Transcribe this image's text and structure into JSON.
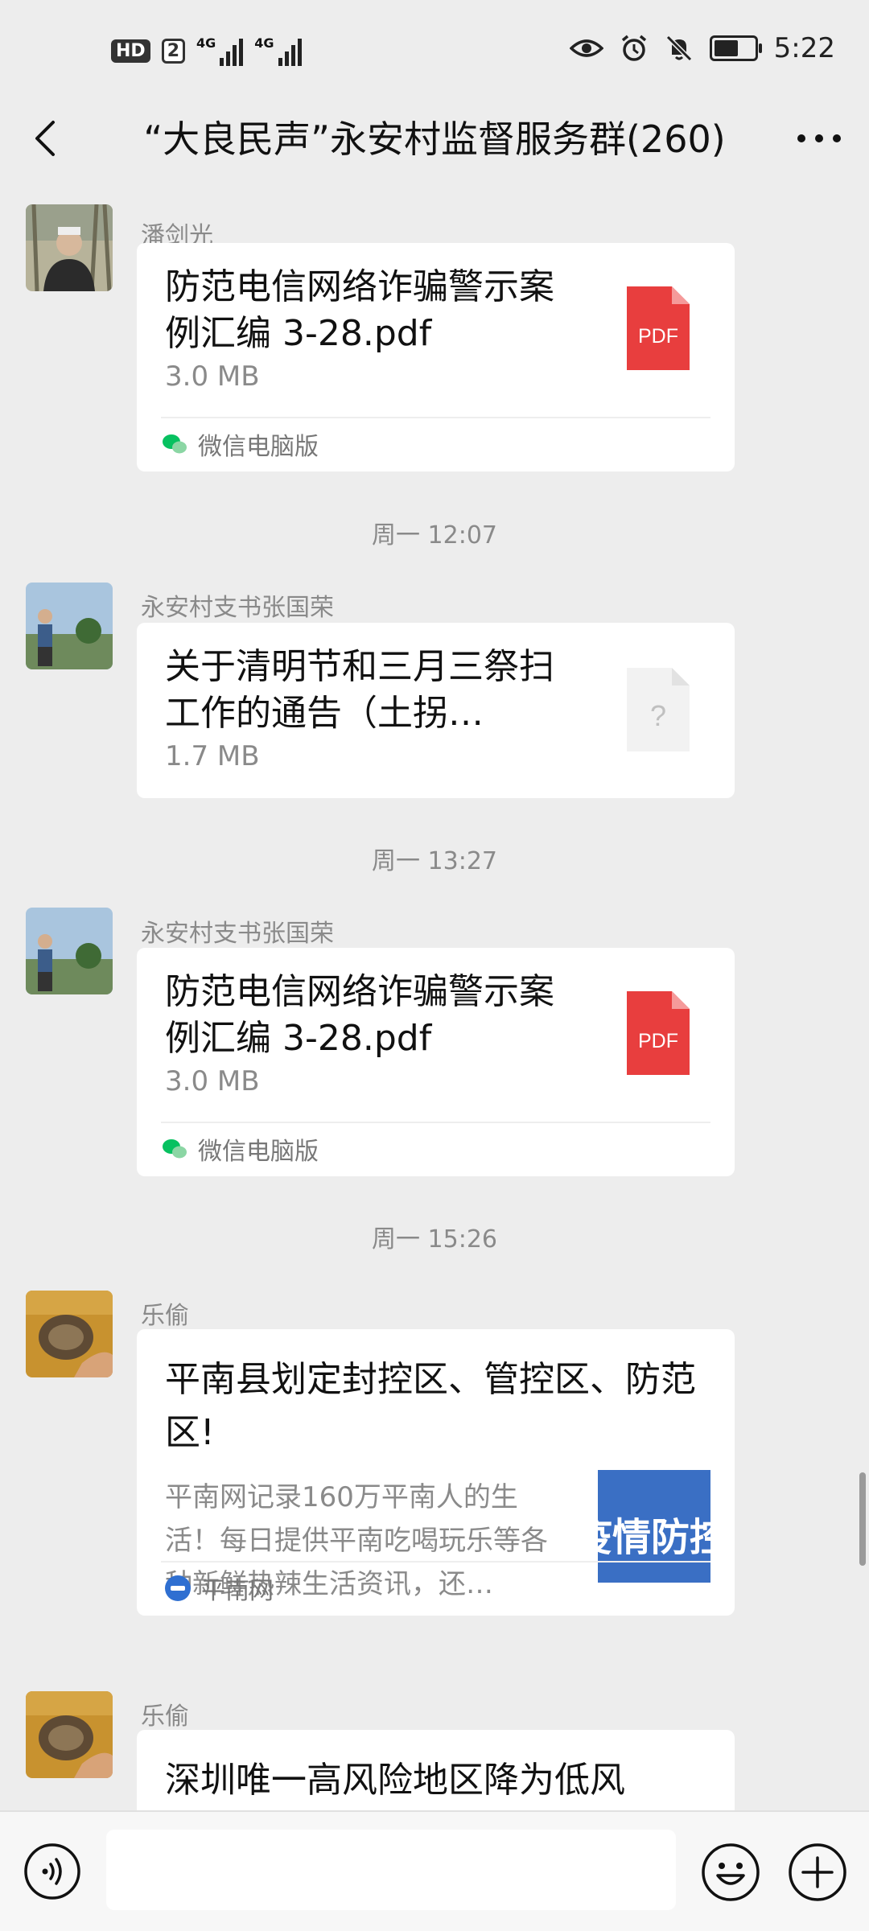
{
  "status_bar": {
    "left_badges": [
      "HD",
      "2"
    ],
    "signal_labels": [
      "4G",
      "4G"
    ],
    "time": "5:22",
    "battery_level": 0.7,
    "icons": [
      "eye-icon",
      "alarm-icon",
      "mute-icon",
      "battery-icon"
    ]
  },
  "header": {
    "title": "“大良民声”永安村监督服务群(260)"
  },
  "messages": [
    {
      "sender": "潘剑光",
      "type": "file",
      "file_name": "防范电信网络诈骗警示案例汇编 3-28.pdf",
      "file_size": "3.0 MB",
      "file_icon": "pdf-icon",
      "icon_label": "PDF",
      "source": "微信电脑版"
    },
    {
      "timestamp": "周一 12:07",
      "sender": "永安村支书张国荣",
      "type": "file",
      "file_name": "关于清明节和三月三祭扫工作的通告（土拐…",
      "file_size": "1.7 MB",
      "file_icon": "unknown-file-icon",
      "icon_label": "?"
    },
    {
      "timestamp": "周一 13:27",
      "sender": "永安村支书张国荣",
      "type": "file",
      "file_name": "防范电信网络诈骗警示案例汇编 3-28.pdf",
      "file_size": "3.0 MB",
      "file_icon": "pdf-icon",
      "icon_label": "PDF",
      "source": "微信电脑版"
    },
    {
      "timestamp": "周一 15:26",
      "sender": "乐偷",
      "type": "link",
      "title": "平南县划定封控区、管控区、防范区!",
      "description": "平南网记录160万平南人的生活！每日提供平南吃喝玩乐等各种新鲜热辣生活资讯，还…",
      "thumbnail_text": "疫情防控",
      "source": "平南网"
    },
    {
      "sender": "乐偷",
      "type": "link",
      "title": "深圳唯一高风险地区降为低风"
    }
  ],
  "input_bar": {
    "placeholder": "",
    "icons": [
      "voice-icon",
      "emoji-icon",
      "plus-icon"
    ]
  },
  "colors": {
    "background": "#ededed",
    "bubble": "#ffffff",
    "pdf_red": "#e83e3e",
    "wechat_green": "#07c160",
    "thumbnail_blue": "#3a6fc4"
  }
}
